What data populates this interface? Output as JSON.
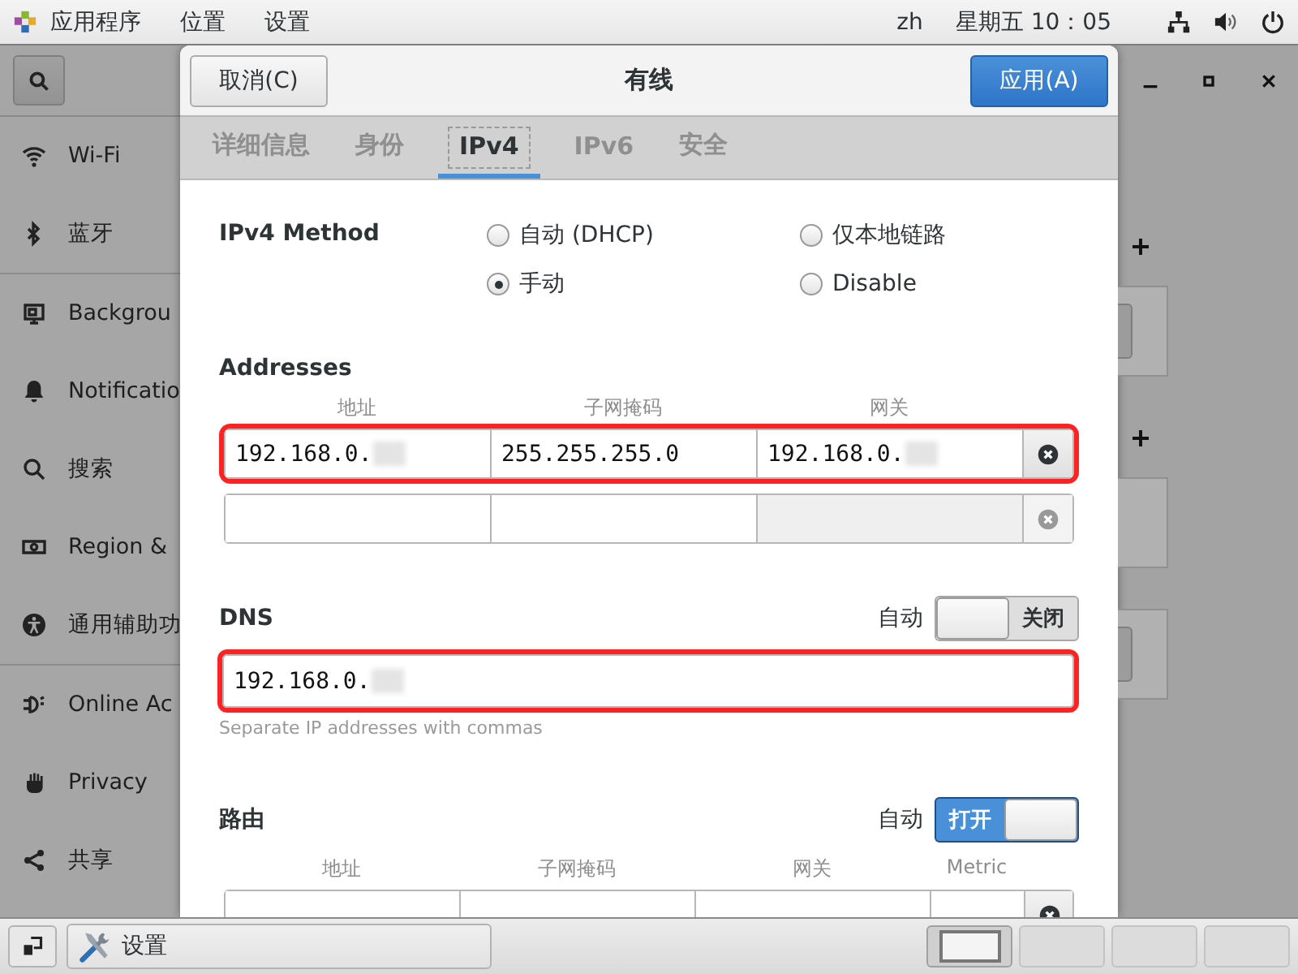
{
  "top_bar": {
    "menus": [
      "应用程序",
      "位置",
      "设置"
    ],
    "language": "zh",
    "clock": "星期五 10：05"
  },
  "sidebar": {
    "groups": [
      [
        "Wi-Fi",
        "蓝牙"
      ],
      [
        "Backgrou",
        "Notificatio",
        "搜索",
        "Region &",
        "通用辅助功"
      ],
      [
        "Online Ac",
        "Privacy",
        "共享"
      ]
    ]
  },
  "dialog": {
    "title": "有线",
    "cancel_button": "取消(C)",
    "apply_button": "应用(A)",
    "tabs": [
      {
        "label": "详细信息",
        "selected": false
      },
      {
        "label": "身份",
        "selected": false
      },
      {
        "label": "IPv4",
        "selected": true
      },
      {
        "label": "IPv6",
        "selected": false
      },
      {
        "label": "安全",
        "selected": false
      }
    ],
    "ipv4_method": {
      "label": "IPv4 Method",
      "options": [
        {
          "label": "自动 (DHCP)",
          "selected": false
        },
        {
          "label": "仅本地链路",
          "selected": false
        },
        {
          "label": "手动",
          "selected": true
        },
        {
          "label": "Disable",
          "selected": false
        }
      ]
    },
    "addresses": {
      "heading": "Addresses",
      "columns": [
        "地址",
        "子网掩码",
        "网关"
      ],
      "rows": [
        {
          "address": {
            "value": "192.168.0.",
            "redacted": true
          },
          "netmask": {
            "value": "255.255.255.0"
          },
          "gateway": {
            "value": "192.168.0.",
            "redacted": true
          },
          "highlighted": true,
          "disabled": false
        },
        {
          "highlighted": false,
          "disabled": true
        }
      ]
    },
    "dns": {
      "heading": "DNS",
      "auto_label": "自动",
      "auto_switch": {
        "on": false,
        "label": "关闭"
      },
      "field": {
        "value": "192.168.0.",
        "redacted": true,
        "highlighted": true
      },
      "hint": "Separate IP addresses with commas"
    },
    "routes": {
      "heading": "路由",
      "auto_label": "自动",
      "auto_switch": {
        "on": true,
        "label": "打开"
      },
      "columns": [
        "地址",
        "子网掩码",
        "网关",
        "Metric"
      ],
      "rows": [
        {
          "highlighted": false
        }
      ]
    }
  },
  "taskbar": {
    "window_button": "设置",
    "workspaces": [
      {
        "selected": true
      },
      {
        "selected": false
      },
      {
        "selected": false
      },
      {
        "selected": false
      }
    ]
  }
}
